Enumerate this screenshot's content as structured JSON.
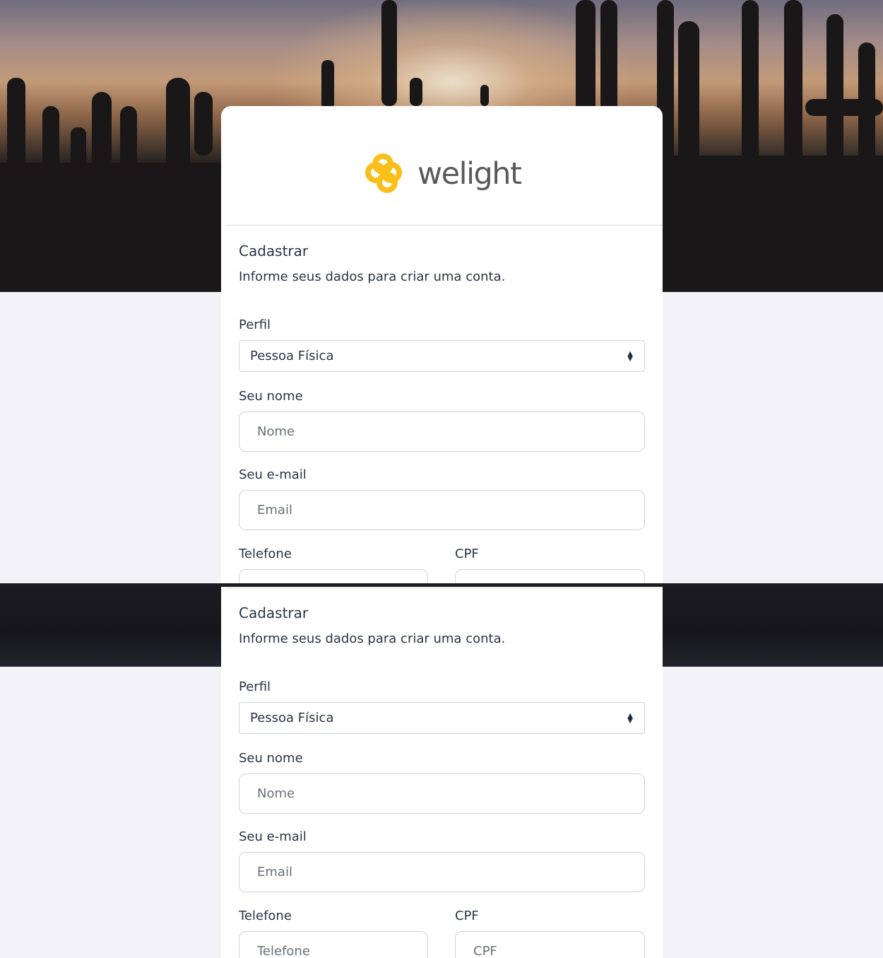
{
  "brand": {
    "name": "welight",
    "logo_icon": "welight-heart-knot-logo",
    "logo_color": "#F9C01B"
  },
  "form": {
    "title": "Cadastrar",
    "subtitle": "Informe seus dados para criar uma conta.",
    "perfil_label": "Perfil",
    "perfil_value": "Pessoa Física",
    "nome_label": "Seu nome",
    "nome_placeholder": "Nome",
    "email_label": "Seu e-mail",
    "email_placeholder": "Email",
    "telefone_label": "Telefone",
    "telefone_placeholder": "Telefone",
    "cpf_label": "CPF",
    "cpf_placeholder": "CPF"
  },
  "colors": {
    "background": "#F2F2F7",
    "card": "#FFFFFF",
    "text": "#2B3443",
    "border": "#CED4DA"
  }
}
